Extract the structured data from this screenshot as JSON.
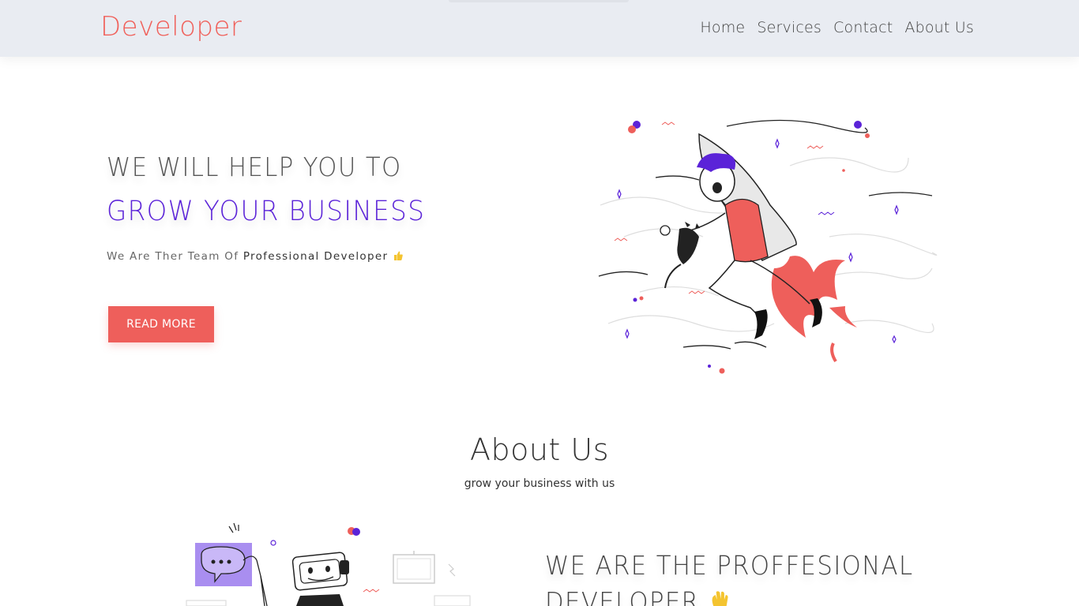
{
  "navbar": {
    "brand": "Developer",
    "links": [
      "Home",
      "Services",
      "Contact",
      "About Us"
    ]
  },
  "hero": {
    "pre_title": "WE WILL HELP YOU TO",
    "main_title": "GROW YOUR BUSINESS",
    "subtitle_plain": "We Are Ther Team Of ",
    "subtitle_strong": "Professional Developer",
    "subtitle_icon": "thumbs-up-icon",
    "cta_label": "READ MORE",
    "illustration": "rocket-man-with-cat-illustration"
  },
  "about": {
    "title": "About Us",
    "subtitle": "grow your business with us",
    "heading_line1": "WE ARE THE PROFFESIONAL",
    "heading_line2": "DEVELOPER",
    "heading_icon": "waving-hand-icon",
    "illustration": "robot-chat-illustration"
  },
  "colors": {
    "brand": "#f0605a",
    "accent_purple": "#5b23d8",
    "button": "#ee5f5b",
    "navbar_bg": "#e9ecf2"
  }
}
